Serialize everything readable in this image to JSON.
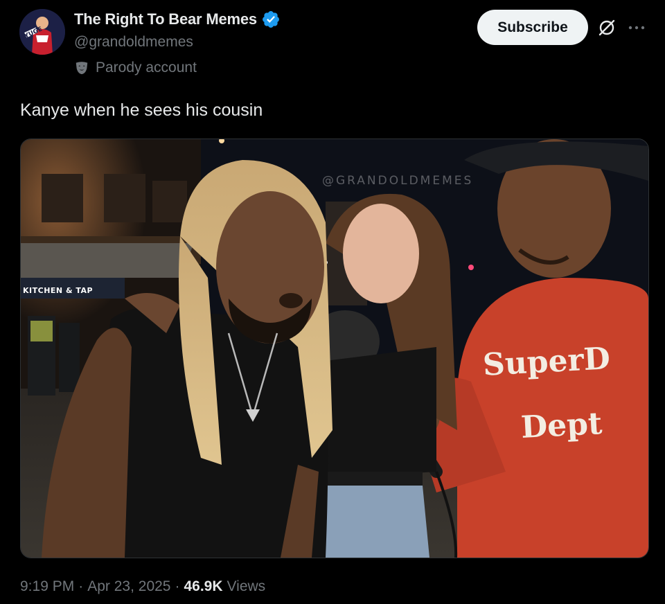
{
  "author": {
    "display_name": "The Right To Bear Memes",
    "handle": "@grandoldmemes",
    "parody_label": "Parody account",
    "avatar_icon": "avatar-image",
    "verified_icon": "verified-badge-icon",
    "verified_color": "#1d9bf0"
  },
  "actions": {
    "subscribe_label": "Subscribe",
    "grok_icon": "grok-icon",
    "more_icon": "more-options-icon"
  },
  "tweet": {
    "text": "Kanye when he sees his cousin"
  },
  "media": {
    "watermark": "@GRANDOLDMEMES",
    "storefront_sign": "KITCHEN & TAP",
    "hoodie_line1": "SuperD",
    "hoodie_line2": "Dept"
  },
  "meta": {
    "time": "9:19 PM",
    "separator1": "·",
    "date": "Apr 23, 2025",
    "separator2": "·",
    "views_count": "46.9K",
    "views_label": "Views"
  },
  "colors": {
    "background": "#000000",
    "primary_text": "#e7e9ea",
    "secondary_text": "#71767b",
    "subscribe_bg": "#eff3f4",
    "hoodie": "#c8412a"
  }
}
